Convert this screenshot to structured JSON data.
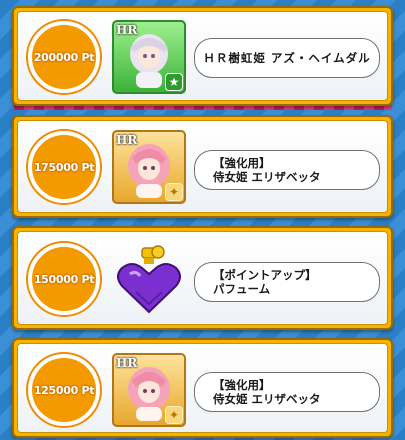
{
  "rewards": [
    {
      "points": "200000 Pt",
      "name_line1": "ＨＲ樹虹姫 アズ・ヘイムダル",
      "name_line2": "",
      "icon": "hr-character-card-icon",
      "hr_label": "HR",
      "frame": "green"
    },
    {
      "points": "175000 Pt",
      "name_line1": "【強化用】",
      "name_line2": "侍女姫 エリザベッタ",
      "icon": "hr-character-card-icon",
      "hr_label": "HR",
      "frame": "gold"
    },
    {
      "points": "150000 Pt",
      "name_line1": "【ポイントアップ】",
      "name_line2": "パフューム",
      "icon": "perfume-bottle-icon",
      "hr_label": "",
      "frame": "none"
    },
    {
      "points": "125000 Pt",
      "name_line1": "【強化用】",
      "name_line2": "侍女姫 エリザベッタ",
      "icon": "hr-character-card-icon",
      "hr_label": "HR",
      "frame": "gold"
    }
  ],
  "colors": {
    "card_border": "#f6b400",
    "badge_orange": "#f29a00",
    "background_blue": "#2b7fc7",
    "accent_pink": "#c21a5c"
  }
}
